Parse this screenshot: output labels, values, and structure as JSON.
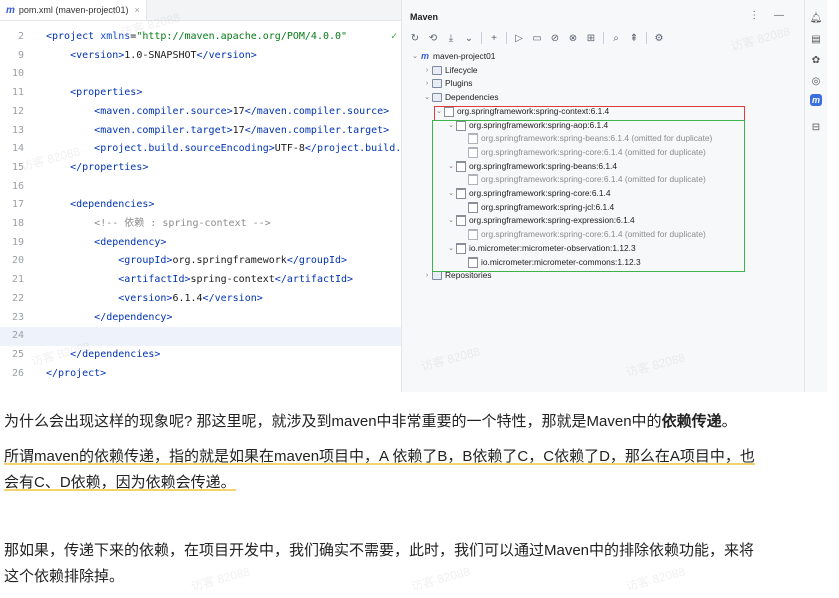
{
  "editor": {
    "tab_title": "pom.xml (maven-project01)",
    "lines": [
      {
        "n": "2",
        "parts": [
          {
            "c": "tg",
            "t": "<project "
          },
          {
            "c": "at",
            "t": "xmlns"
          },
          {
            "c": "",
            "t": "="
          },
          {
            "c": "st",
            "t": "\"http://maven.apache.org/POM/4.0.0\""
          }
        ]
      },
      {
        "n": "9",
        "parts": [
          {
            "c": "",
            "t": "    "
          },
          {
            "c": "tg",
            "t": "<version>"
          },
          {
            "c": "",
            "t": "1.0-SNAPSHOT"
          },
          {
            "c": "tg",
            "t": "</version>"
          }
        ]
      },
      {
        "n": "10",
        "parts": []
      },
      {
        "n": "11",
        "parts": [
          {
            "c": "",
            "t": "    "
          },
          {
            "c": "tg",
            "t": "<properties>"
          }
        ]
      },
      {
        "n": "12",
        "parts": [
          {
            "c": "",
            "t": "        "
          },
          {
            "c": "tg",
            "t": "<maven.compiler.source>"
          },
          {
            "c": "",
            "t": "17"
          },
          {
            "c": "tg",
            "t": "</maven.compiler.source>"
          }
        ]
      },
      {
        "n": "13",
        "parts": [
          {
            "c": "",
            "t": "        "
          },
          {
            "c": "tg",
            "t": "<maven.compiler.target>"
          },
          {
            "c": "",
            "t": "17"
          },
          {
            "c": "tg",
            "t": "</maven.compiler.target>"
          }
        ]
      },
      {
        "n": "14",
        "parts": [
          {
            "c": "",
            "t": "        "
          },
          {
            "c": "tg",
            "t": "<project.build.sourceEncoding>"
          },
          {
            "c": "",
            "t": "UTF-8"
          },
          {
            "c": "tg",
            "t": "</project.build.s"
          }
        ]
      },
      {
        "n": "15",
        "parts": [
          {
            "c": "",
            "t": "    "
          },
          {
            "c": "tg",
            "t": "</properties>"
          }
        ]
      },
      {
        "n": "16",
        "parts": []
      },
      {
        "n": "17",
        "parts": [
          {
            "c": "",
            "t": "    "
          },
          {
            "c": "tg",
            "t": "<dependencies>"
          }
        ]
      },
      {
        "n": "18",
        "parts": [
          {
            "c": "",
            "t": "        "
          },
          {
            "c": "cm",
            "t": "<!-- 依赖 : spring-context -->"
          }
        ]
      },
      {
        "n": "19",
        "parts": [
          {
            "c": "",
            "t": "        "
          },
          {
            "c": "tg",
            "t": "<dependency>"
          }
        ]
      },
      {
        "n": "20",
        "parts": [
          {
            "c": "",
            "t": "            "
          },
          {
            "c": "tg",
            "t": "<groupId>"
          },
          {
            "c": "",
            "t": "org.springframework"
          },
          {
            "c": "tg",
            "t": "</groupId>"
          }
        ]
      },
      {
        "n": "21",
        "parts": [
          {
            "c": "",
            "t": "            "
          },
          {
            "c": "tg",
            "t": "<artifactId>"
          },
          {
            "c": "",
            "t": "spring-context"
          },
          {
            "c": "tg",
            "t": "</artifactId>"
          }
        ]
      },
      {
        "n": "22",
        "parts": [
          {
            "c": "",
            "t": "            "
          },
          {
            "c": "tg",
            "t": "<version>"
          },
          {
            "c": "",
            "t": "6.1.4"
          },
          {
            "c": "tg",
            "t": "</version>"
          }
        ]
      },
      {
        "n": "23",
        "parts": [
          {
            "c": "",
            "t": "        "
          },
          {
            "c": "tg",
            "t": "</dependency>"
          }
        ]
      },
      {
        "n": "24",
        "parts": []
      },
      {
        "n": "25",
        "parts": [
          {
            "c": "",
            "t": "    "
          },
          {
            "c": "tg",
            "t": "</dependencies>"
          }
        ]
      },
      {
        "n": "26",
        "parts": [
          {
            "c": "tg",
            "t": "</project>"
          }
        ]
      }
    ]
  },
  "maven": {
    "title": "Maven",
    "tree": [
      {
        "level": 0,
        "arrow": "v",
        "icon": "m",
        "label": "maven-project01",
        "dim": false
      },
      {
        "level": 1,
        "arrow": ">",
        "icon": "folder",
        "label": "Lifecycle",
        "dim": false
      },
      {
        "level": 1,
        "arrow": ">",
        "icon": "folder",
        "label": "Plugins",
        "dim": false
      },
      {
        "level": 1,
        "arrow": "v",
        "icon": "folder",
        "label": "Dependencies",
        "dim": false
      },
      {
        "level": 2,
        "arrow": "v",
        "icon": "lib",
        "label": "org.springframework:spring-context:6.1.4",
        "dim": false
      },
      {
        "level": 3,
        "arrow": "v",
        "icon": "lib",
        "label": "org.springframework:spring-aop:6.1.4",
        "dim": false
      },
      {
        "level": 4,
        "arrow": "",
        "icon": "libd",
        "label": "org.springframework:spring-beans:6.1.4 (omitted for duplicate)",
        "dim": true
      },
      {
        "level": 4,
        "arrow": "",
        "icon": "libd",
        "label": "org.springframework:spring-core:6.1.4 (omitted for duplicate)",
        "dim": true
      },
      {
        "level": 3,
        "arrow": "v",
        "icon": "lib",
        "label": "org.springframework:spring-beans:6.1.4",
        "dim": false
      },
      {
        "level": 4,
        "arrow": "",
        "icon": "libd",
        "label": "org.springframework:spring-core:6.1.4 (omitted for duplicate)",
        "dim": true
      },
      {
        "level": 3,
        "arrow": "v",
        "icon": "lib",
        "label": "org.springframework:spring-core:6.1.4",
        "dim": false
      },
      {
        "level": 4,
        "arrow": "",
        "icon": "lib",
        "label": "org.springframework:spring-jcl:6.1.4",
        "dim": false
      },
      {
        "level": 3,
        "arrow": "v",
        "icon": "lib",
        "label": "org.springframework:spring-expression:6.1.4",
        "dim": false
      },
      {
        "level": 4,
        "arrow": "",
        "icon": "libd",
        "label": "org.springframework:spring-core:6.1.4 (omitted for duplicate)",
        "dim": true
      },
      {
        "level": 3,
        "arrow": "v",
        "icon": "lib",
        "label": "io.micrometer:micrometer-observation:1.12.3",
        "dim": false
      },
      {
        "level": 4,
        "arrow": "",
        "icon": "lib",
        "label": "io.micrometer:micrometer-commons:1.12.3",
        "dim": false
      },
      {
        "level": 1,
        "arrow": ">",
        "icon": "folder",
        "label": "Repositories",
        "dim": false
      }
    ]
  },
  "article": {
    "p1_a": "为什么会出现这样的现象呢? 那这里呢，就涉及到maven中非常重要的一个特性，那就是Maven中的",
    "p1_b": "依赖传递",
    "p1_c": "。",
    "p2_l1": "所谓maven的依赖传递，指的就是如果在maven项目中，A 依赖了B，B依赖了C，C依赖了D，那么在A项目中，也",
    "p2_l2": "会有C、D依赖，因为依赖会传递。",
    "p3_l1": "那如果，传递下来的依赖，在项目开发中，我们确实不需要，此时，我们可以通过Maven中的排除依赖功能，来将",
    "p3_l2": "这个依赖排除掉。"
  },
  "watermark": "访客 82088",
  "colors": {
    "accent": "#3b5bdb",
    "red_box": "#e23b3b",
    "green_box": "#3cb44b",
    "highlight": "#f3d36b"
  }
}
